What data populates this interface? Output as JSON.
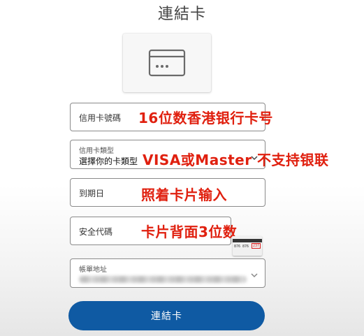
{
  "page": {
    "title": "連結卡"
  },
  "card_number": {
    "label": "信用卡號碼",
    "annotation": "16位数香港银行卡号"
  },
  "card_type": {
    "label": "信用卡類型",
    "selected": "選擇你的卡類型",
    "annotation": "VISA或Master 不支持银联"
  },
  "expiry": {
    "label": "到期日",
    "annotation": "照着卡片输入"
  },
  "security_code": {
    "label": "安全代碼",
    "annotation": "卡片背面3位数",
    "sample_digits": "876 876",
    "sample_cvv": "237"
  },
  "billing_address": {
    "label": "帳單地址"
  },
  "submit": {
    "label": "連結卡"
  },
  "icons": {
    "card": "credit-card-icon",
    "chevron": "chevron-down-icon"
  },
  "colors": {
    "primary_button": "#0f5aa3",
    "annotation": "#e0200f",
    "border": "#8b8b8b"
  }
}
